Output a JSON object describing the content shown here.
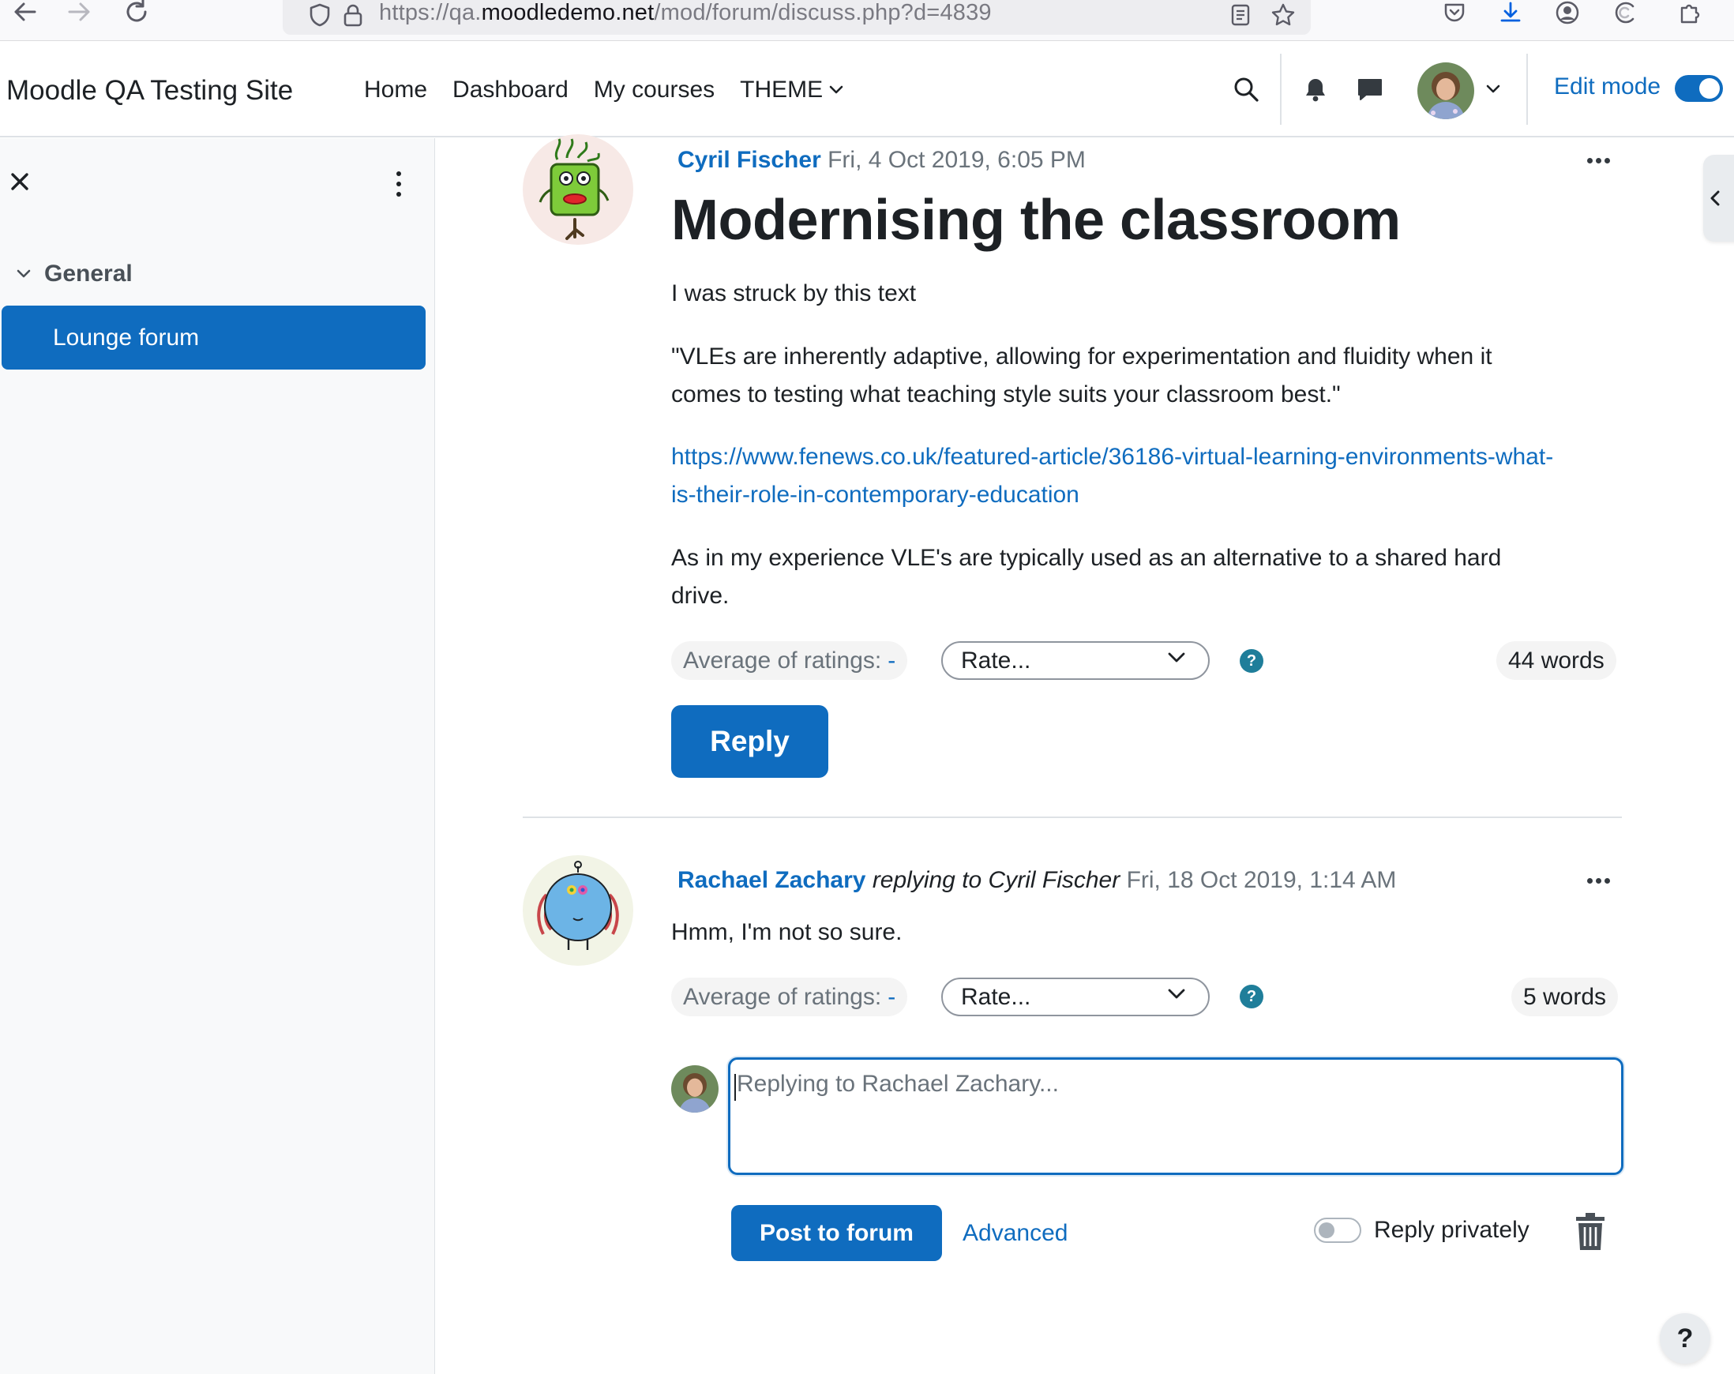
{
  "browser": {
    "url_prefix": "https://qa.",
    "url_host": "moodledemo.net",
    "url_path": "/mod/forum/discuss.php?d=4839"
  },
  "navbar": {
    "site_name": "Moodle QA Testing Site",
    "links": [
      "Home",
      "Dashboard",
      "My courses",
      "THEME"
    ],
    "edit_mode_label": "Edit mode",
    "edit_mode_on": true
  },
  "drawer": {
    "section_title": "General",
    "active_item": "Lounge forum"
  },
  "discussion": {
    "post": {
      "author": "Cyril Fischer",
      "date": "Fri, 4 Oct 2019, 6:05 PM",
      "title": "Modernising the classroom",
      "paragraph1": "I was struck by this text",
      "quote": "\"VLEs are inherently adaptive, allowing for experimentation and fluidity when it comes to testing what teaching style suits your classroom best.\"",
      "link": "https://www.fenews.co.uk/featured-article/36186-virtual-learning-environments-what-is-their-role-in-contemporary-education",
      "paragraph3": "As in my experience  VLE's are typically used as an alternative to a shared hard drive.",
      "avg_label": "Average of ratings:",
      "avg_value": "-",
      "rate_label": "Rate...",
      "word_count": "44 words",
      "reply_label": "Reply"
    },
    "reply": {
      "author": "Rachael Zachary",
      "replying_to": "replying to Cyril Fischer",
      "date": "Fri, 18 Oct 2019, 1:14 AM",
      "text": "Hmm, I'm not so sure.",
      "avg_label": "Average of ratings:",
      "avg_value": "-",
      "rate_label": "Rate...",
      "word_count": "5 words"
    },
    "inline_reply": {
      "placeholder": "Replying to Rachael Zachary...",
      "post_label": "Post to forum",
      "advanced_label": "Advanced",
      "private_label": "Reply privately",
      "private_on": false
    }
  },
  "help_button": "?",
  "colors": {
    "brand": "#0f6cbf",
    "help": "#1f7e9a"
  }
}
